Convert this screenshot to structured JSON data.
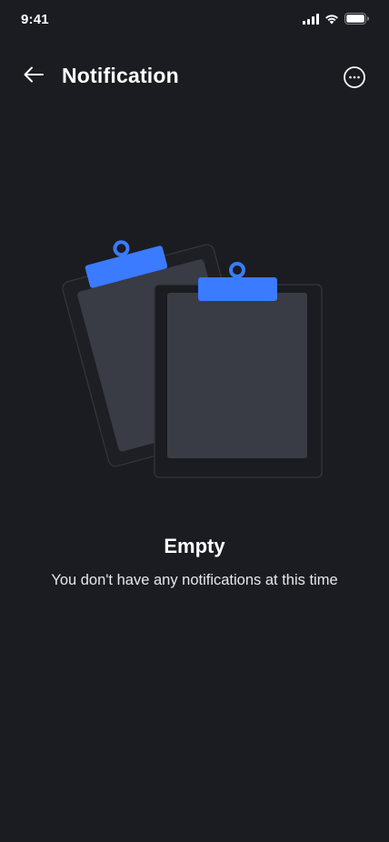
{
  "status_bar": {
    "time": "9:41"
  },
  "header": {
    "title": "Notification",
    "back_icon": "arrow-left-icon",
    "more_icon": "more-horizontal-circle-icon"
  },
  "empty_state": {
    "illustration": "clipboards-illustration",
    "title": "Empty",
    "subtitle": "You don't have any notifications at this time"
  },
  "colors": {
    "background": "#1b1c21",
    "accent": "#3a7bff",
    "clipboard_board": "#1e1f24",
    "clipboard_paper": "#3a3c45"
  }
}
